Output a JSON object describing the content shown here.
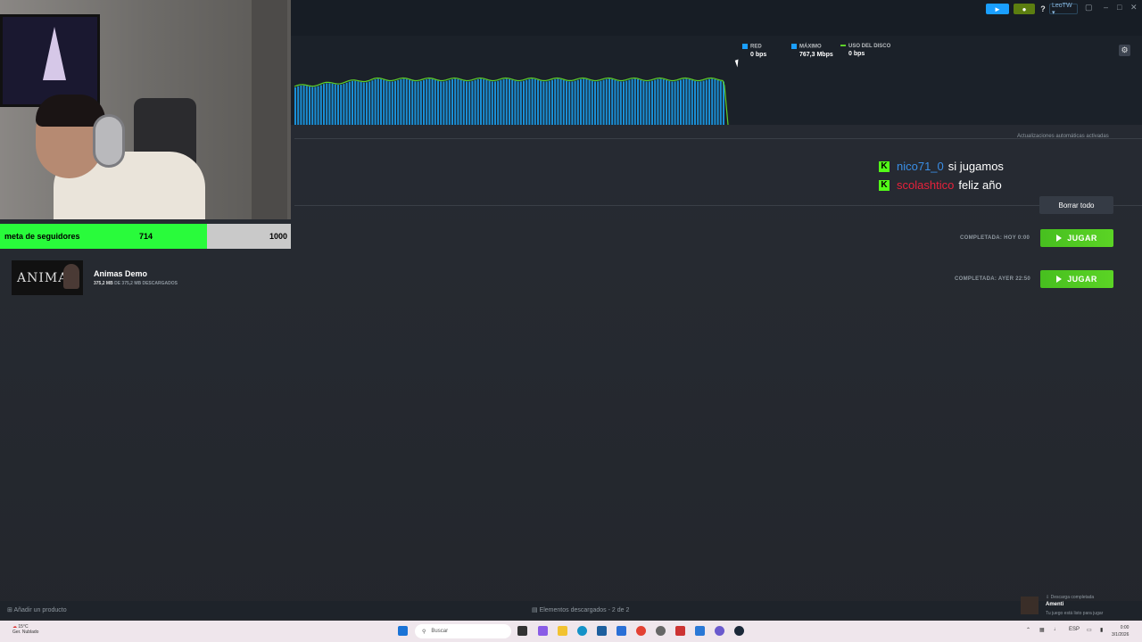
{
  "titlebar": {
    "help_label": "?",
    "username": "LeoTW ▾",
    "icons": [
      "megaphone-icon",
      "bell-icon",
      "help-icon",
      "minimize-icon",
      "maximize-icon",
      "close-icon"
    ]
  },
  "graph": {
    "legend": [
      {
        "label": "RED",
        "value": "0 bps",
        "color": "#1a9fff"
      },
      {
        "label": "MÁXIMO",
        "value": "767,3 Mbps",
        "color": "#1a9fff"
      },
      {
        "label": "USO DEL DISCO",
        "value": "0 bps",
        "color": "#5ed12a"
      }
    ],
    "bar_color": "#1a8fd6",
    "line_color": "#5ed12a"
  },
  "auto_updates": "Actualizaciones automáticas activadas",
  "chat": [
    {
      "user": "nico71_0",
      "message": "si jugamos",
      "user_color": "#3a8ee6"
    },
    {
      "user": "scolashtico",
      "message": "feliz año",
      "user_color": "#e8213b"
    }
  ],
  "clear_all": "Borrar todo",
  "downloads": [
    {
      "completed": "COMPLETADA: HOY 0:00",
      "play": "JUGAR"
    },
    {
      "name": "Animas Demo",
      "size_done": "375,2 MB",
      "size_rest": " DE 375,2 MB DESCARGADOS",
      "thumb_text": "ANIMAS",
      "completed": "COMPLETADA: AYER 22:50",
      "play": "JUGAR"
    }
  ],
  "goal": {
    "label": "meta de seguidores",
    "current": "714",
    "max": "1000",
    "progress": 0.714
  },
  "footer": {
    "add_product": "Añadir un producto",
    "downloaded_items": "Elementos descargados - 2 de 2"
  },
  "toast": {
    "line1": "⇩ Descarga completada",
    "game": "Amenti",
    "line3": "Tu juego está listo para jugar"
  },
  "taskbar": {
    "temp": "15°C",
    "weather": "Ger. Nublado",
    "search_placeholder": "Buscar",
    "lang": "ESP",
    "time": "0:00",
    "date": "3/1/2026"
  }
}
